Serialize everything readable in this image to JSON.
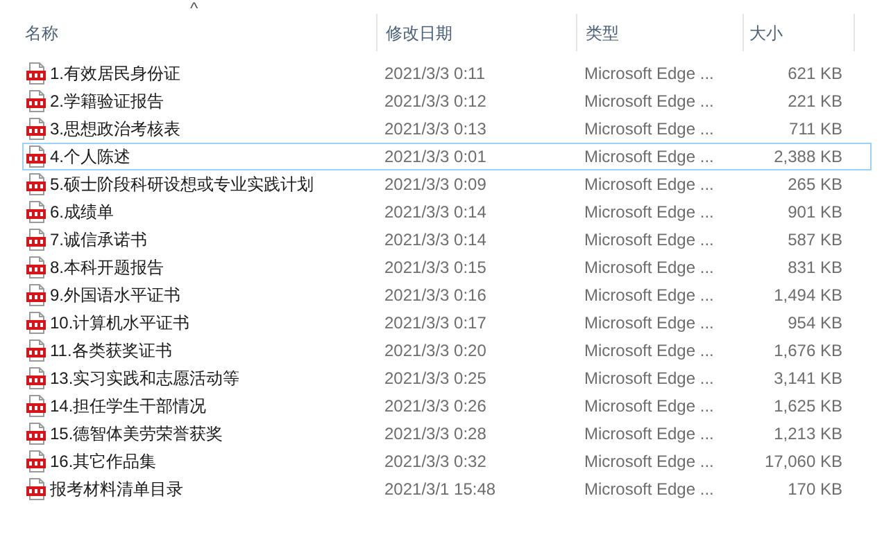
{
  "sort_indicator": "^",
  "columns": [
    {
      "label": "名称"
    },
    {
      "label": "修改日期"
    },
    {
      "label": "类型"
    },
    {
      "label": "大小"
    }
  ],
  "rows": [
    {
      "name": "1.有效居民身份证",
      "date": "2021/3/3 0:11",
      "type": "Microsoft Edge ...",
      "size": "621 KB",
      "focused": false
    },
    {
      "name": "2.学籍验证报告",
      "date": "2021/3/3 0:12",
      "type": "Microsoft Edge ...",
      "size": "221 KB",
      "focused": false
    },
    {
      "name": "3.思想政治考核表",
      "date": "2021/3/3 0:13",
      "type": "Microsoft Edge ...",
      "size": "711 KB",
      "focused": false
    },
    {
      "name": "4.个人陈述",
      "date": "2021/3/3 0:01",
      "type": "Microsoft Edge ...",
      "size": "2,388 KB",
      "focused": true
    },
    {
      "name": "5.硕士阶段科研设想或专业实践计划",
      "date": "2021/3/3 0:09",
      "type": "Microsoft Edge ...",
      "size": "265 KB",
      "focused": false
    },
    {
      "name": "6.成绩单",
      "date": "2021/3/3 0:14",
      "type": "Microsoft Edge ...",
      "size": "901 KB",
      "focused": false
    },
    {
      "name": "7.诚信承诺书",
      "date": "2021/3/3 0:14",
      "type": "Microsoft Edge ...",
      "size": "587 KB",
      "focused": false
    },
    {
      "name": "8.本科开题报告",
      "date": "2021/3/3 0:15",
      "type": "Microsoft Edge ...",
      "size": "831 KB",
      "focused": false
    },
    {
      "name": "9.外国语水平证书",
      "date": "2021/3/3 0:16",
      "type": "Microsoft Edge ...",
      "size": "1,494 KB",
      "focused": false
    },
    {
      "name": "10.计算机水平证书",
      "date": "2021/3/3 0:17",
      "type": "Microsoft Edge ...",
      "size": "954 KB",
      "focused": false
    },
    {
      "name": "11.各类获奖证书",
      "date": "2021/3/3 0:20",
      "type": "Microsoft Edge ...",
      "size": "1,676 KB",
      "focused": false
    },
    {
      "name": "13.实习实践和志愿活动等",
      "date": "2021/3/3 0:25",
      "type": "Microsoft Edge ...",
      "size": "3,141 KB",
      "focused": false
    },
    {
      "name": "14.担任学生干部情况",
      "date": "2021/3/3 0:26",
      "type": "Microsoft Edge ...",
      "size": "1,625 KB",
      "focused": false
    },
    {
      "name": "15.德智体美劳荣誉获奖",
      "date": "2021/3/3 0:28",
      "type": "Microsoft Edge ...",
      "size": "1,213 KB",
      "focused": false
    },
    {
      "name": "16.其它作品集",
      "date": "2021/3/3 0:32",
      "type": "Microsoft Edge ...",
      "size": "17,060 KB",
      "focused": false
    },
    {
      "name": "报考材料清单目录",
      "date": "2021/3/1 15:48",
      "type": "Microsoft Edge ...",
      "size": "170 KB",
      "focused": false
    }
  ]
}
